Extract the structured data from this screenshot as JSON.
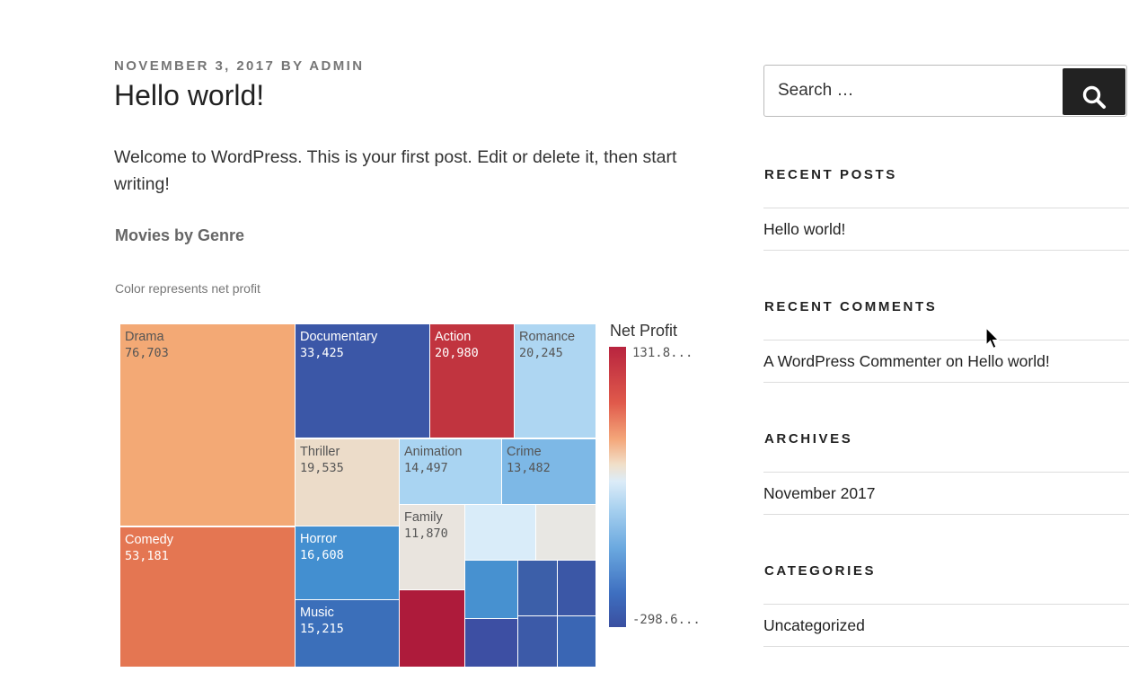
{
  "post": {
    "date": "November 3, 2017",
    "by": "by",
    "author": "admin",
    "title": "Hello world!",
    "body": "Welcome to WordPress. This is your first post. Edit or delete it, then start writing!"
  },
  "chart_data": {
    "type": "treemap",
    "title": "Movies by Genre",
    "subtitle": "Color represents net profit",
    "legend": {
      "title": "Net Profit",
      "max_label": "131.8...",
      "min_label": "-298.6..."
    },
    "tiles": [
      {
        "name": "Drama",
        "value": "76,703",
        "color": "#f3a975",
        "text_color": "#555555"
      },
      {
        "name": "Comedy",
        "value": "53,181",
        "color": "#e47652",
        "text_color": "#ffffff"
      },
      {
        "name": "Documentary",
        "value": "33,425",
        "color": "#3b57a7",
        "text_color": "#ffffff"
      },
      {
        "name": "Action",
        "value": "20,980",
        "color": "#c1343f",
        "text_color": "#ffffff"
      },
      {
        "name": "Romance",
        "value": "20,245",
        "color": "#aed6f2",
        "text_color": "#555555"
      },
      {
        "name": "Thriller",
        "value": "19,535",
        "color": "#ecdcc9",
        "text_color": "#555555"
      },
      {
        "name": "Animation",
        "value": "14,497",
        "color": "#a9d4f2",
        "text_color": "#555555"
      },
      {
        "name": "Crime",
        "value": "13,482",
        "color": "#7db8e6",
        "text_color": "#555555"
      },
      {
        "name": "Horror",
        "value": "16,608",
        "color": "#438fd0",
        "text_color": "#ffffff"
      },
      {
        "name": "Music",
        "value": "15,215",
        "color": "#3b6fba",
        "text_color": "#ffffff"
      },
      {
        "name": "Family",
        "value": "11,870",
        "color": "#e9e4de",
        "text_color": "#555555"
      },
      {
        "name": "",
        "value": "",
        "color": "#d9ecf9",
        "text_color": "#555555"
      },
      {
        "name": "",
        "value": "",
        "color": "#e8e7e3",
        "text_color": "#555555"
      },
      {
        "name": "",
        "value": "",
        "color": "#ae1b3b",
        "text_color": "#ffffff"
      },
      {
        "name": "",
        "value": "",
        "color": "#4791d0",
        "text_color": "#ffffff"
      },
      {
        "name": "",
        "value": "",
        "color": "#3c5fa9",
        "text_color": "#ffffff"
      },
      {
        "name": "",
        "value": "",
        "color": "#3b57a6",
        "text_color": "#ffffff"
      },
      {
        "name": "",
        "value": "",
        "color": "#3d4fa3",
        "text_color": "#ffffff"
      },
      {
        "name": "",
        "value": "",
        "color": "#3c5aa8",
        "text_color": "#ffffff"
      },
      {
        "name": "",
        "value": "",
        "color": "#3a66b4",
        "text_color": "#ffffff"
      }
    ]
  },
  "sidebar": {
    "search_placeholder": "Search …",
    "search_button_icon": "search-icon",
    "recent_posts_title": "Recent Posts",
    "recent_posts": [
      "Hello world!"
    ],
    "recent_comments_title": "Recent Comments",
    "comment_author": "A WordPress Commenter",
    "comment_on": "on",
    "comment_post": "Hello world!",
    "archives_title": "Archives",
    "archives": [
      "November 2017"
    ],
    "categories_title": "Categories",
    "categories": [
      "Uncategorized"
    ]
  }
}
